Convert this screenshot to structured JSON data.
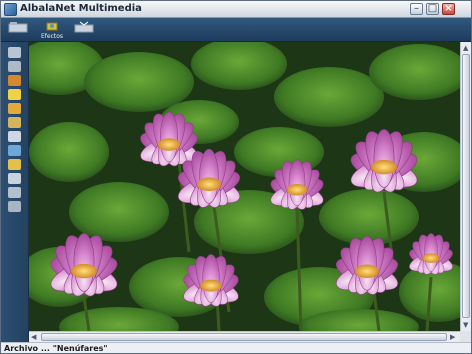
{
  "window": {
    "title": "AlbalaNet Multimedia"
  },
  "toolbar": {
    "effects_label": "Efectos"
  },
  "status": {
    "text": "Archivo ... \"Nenúfares\""
  },
  "colors": {
    "chrome_blue": "#264a6e",
    "lily_pink": "#c86bc4"
  }
}
